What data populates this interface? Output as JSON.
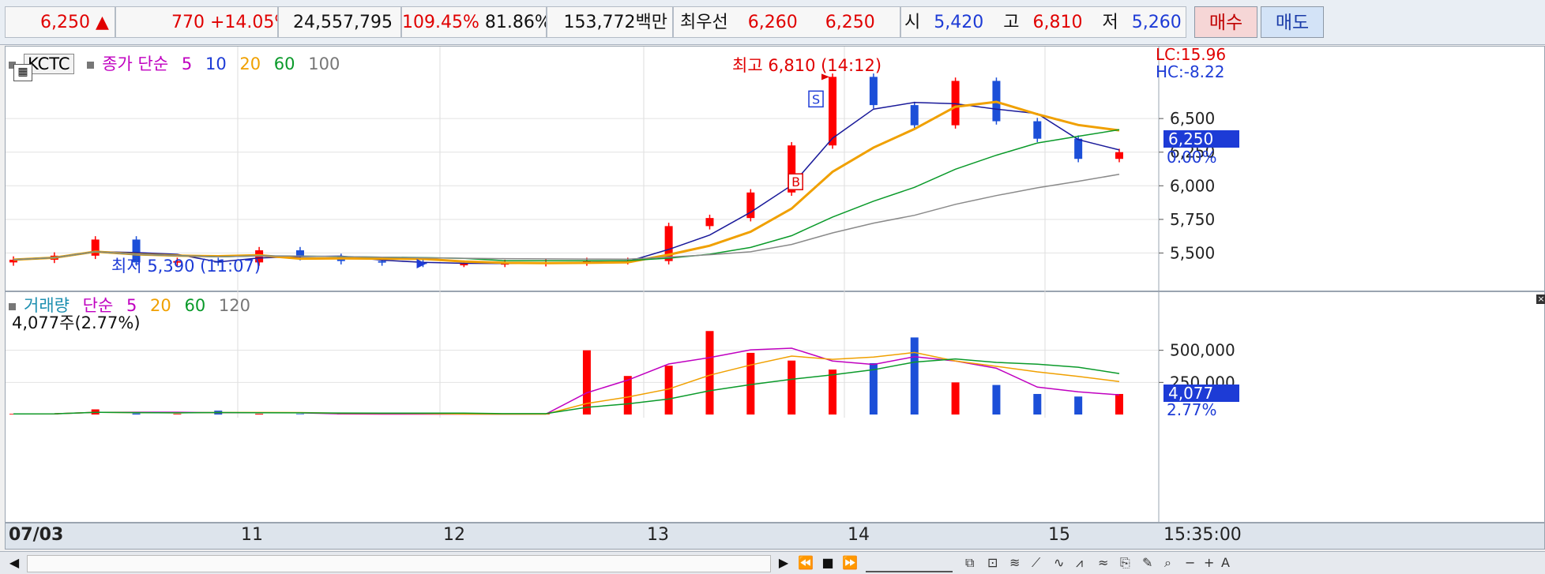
{
  "quote": {
    "price": "6,250",
    "arrow": "▲",
    "change": "770",
    "change_pct": "+14.05%",
    "volume": "24,557,795",
    "vol_ratio": "109.45%",
    "turnover": "81.86%",
    "amount": "153,772백만",
    "best_label": "최우선",
    "best_ask": "6,260",
    "best_bid": "6,250",
    "open_label": "시",
    "open": "5,420",
    "high_label": "고",
    "high": "6,810",
    "low_label": "저",
    "low": "5,260"
  },
  "buttons": {
    "buy": "매수",
    "sell": "매도"
  },
  "price_panel": {
    "symbol": "KCTC",
    "legend_label": "종가 단순",
    "ma": [
      "5",
      "10",
      "20",
      "60",
      "100"
    ],
    "lc": "LC:15.96",
    "hc": "HC:-8.22",
    "current_tag": "6,250",
    "current_pct": "0.00%",
    "high_note": "최고 6,810 (14:12)",
    "low_note": "최저 5,390 (11:07)",
    "marker_s": "S",
    "marker_b": "B"
  },
  "volume_panel": {
    "legend_label": "거래량",
    "legend_kind": "단순",
    "ma": [
      "5",
      "20",
      "60",
      "120"
    ],
    "info": "4,077주(2.77%)",
    "current_tag": "4,077",
    "current_pct": "2.77%"
  },
  "time_label": "15:35:00",
  "colors": {
    "up": "#ff0000",
    "down": "#1c4fd8",
    "ma5": "#1a1a9a",
    "ma20": "#f0a000",
    "ma60": "#0a9a2a",
    "ma100": "#8a8a8a"
  },
  "chart_data": [
    {
      "type": "candlestick",
      "title": "KCTC",
      "x": [
        "07/03",
        "11",
        "12",
        "13",
        "14",
        "15"
      ],
      "ylim": [
        5250,
        7000
      ],
      "yticks": [
        "5,500",
        "5,750",
        "6,000",
        "6,250",
        "6,500"
      ],
      "series": [
        {
          "name": "종가",
          "values": [
            5450,
            5480,
            5600,
            5430,
            5440,
            5430,
            5520,
            5470,
            5440,
            5430,
            5420,
            5420,
            5425,
            5430,
            5440,
            5440,
            5700,
            5760,
            5950,
            6300,
            6810,
            6600,
            6450,
            6780,
            6480,
            6350,
            6200,
            6250
          ]
        }
      ],
      "annotations": [
        "최고 6,810 (14:12)",
        "최저 5,390 (11:07)"
      ]
    },
    {
      "type": "bar",
      "title": "거래량",
      "ylim": [
        0,
        750000
      ],
      "yticks": [
        "250,000",
        "500,000"
      ],
      "series": [
        {
          "name": "거래량",
          "values": [
            5000,
            6000,
            40000,
            8000,
            5000,
            30000,
            6000,
            4000,
            3000,
            3000,
            3000,
            3000,
            4000,
            4000,
            500000,
            300000,
            380000,
            650000,
            480000,
            420000,
            350000,
            400000,
            600000,
            250000,
            230000,
            160000,
            140000,
            160000
          ]
        }
      ]
    }
  ]
}
